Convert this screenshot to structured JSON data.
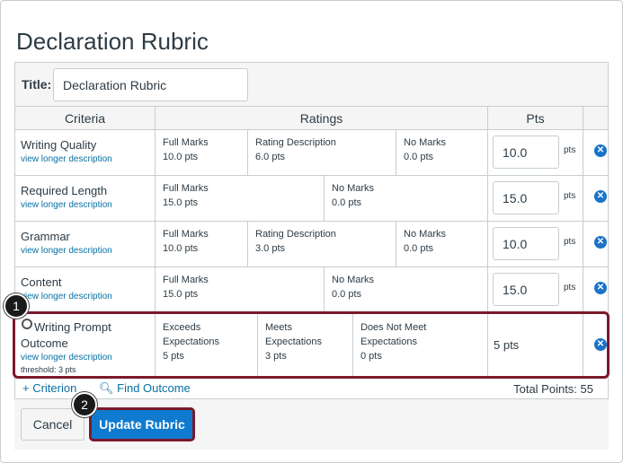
{
  "page_title": "Declaration Rubric",
  "rubric": {
    "title_label": "Title:",
    "title_value": "Declaration Rubric",
    "headers": {
      "criteria": "Criteria",
      "ratings": "Ratings",
      "pts": "Pts"
    },
    "rows": [
      {
        "name": "Writing Quality",
        "link": "view longer description",
        "ratings": [
          {
            "title": "Full Marks",
            "pts": "10.0 pts"
          },
          {
            "title": "Rating Description",
            "pts": "6.0 pts"
          },
          {
            "title": "No Marks",
            "pts": "0.0 pts"
          }
        ],
        "points": "10.0",
        "pts_suffix": "pts"
      },
      {
        "name": "Required Length",
        "link": "view longer description",
        "ratings": [
          {
            "title": "Full Marks",
            "pts": "15.0 pts"
          },
          {
            "title": "No Marks",
            "pts": "0.0 pts"
          }
        ],
        "points": "15.0",
        "pts_suffix": "pts"
      },
      {
        "name": "Grammar",
        "link": "view longer description",
        "ratings": [
          {
            "title": "Full Marks",
            "pts": "10.0 pts"
          },
          {
            "title": "Rating Description",
            "pts": "3.0 pts"
          },
          {
            "title": "No Marks",
            "pts": "0.0 pts"
          }
        ],
        "points": "10.0",
        "pts_suffix": "pts"
      },
      {
        "name": "Content",
        "link": "view longer description",
        "ratings": [
          {
            "title": "Full Marks",
            "pts": "15.0 pts"
          },
          {
            "title": "No Marks",
            "pts": "0.0 pts"
          }
        ],
        "points": "15.0",
        "pts_suffix": "pts"
      }
    ],
    "outcome": {
      "name_line1": "Writing Prompt",
      "name_line2": "Outcome",
      "link": "view longer description",
      "threshold": "threshold: 3 pts",
      "ratings": [
        {
          "title1": "Exceeds",
          "title2": "Expectations",
          "pts": "5 pts"
        },
        {
          "title1": "Meets",
          "title2": "Expectations",
          "pts": "3 pts"
        },
        {
          "title1": "Does Not Meet",
          "title2": "Expectations",
          "pts": "0 pts"
        }
      ],
      "points": "5 pts"
    },
    "add_criterion": "+ Criterion",
    "find_outcome": "Find Outcome",
    "total_points": "Total Points: 55"
  },
  "buttons": {
    "cancel": "Cancel",
    "update": "Update Rubric"
  },
  "callouts": {
    "one": "1",
    "two": "2"
  },
  "colors": {
    "link": "#0770a3",
    "primary": "#0f7bd0",
    "highlight": "#7a1a2a",
    "delete": "#1a73c8"
  }
}
